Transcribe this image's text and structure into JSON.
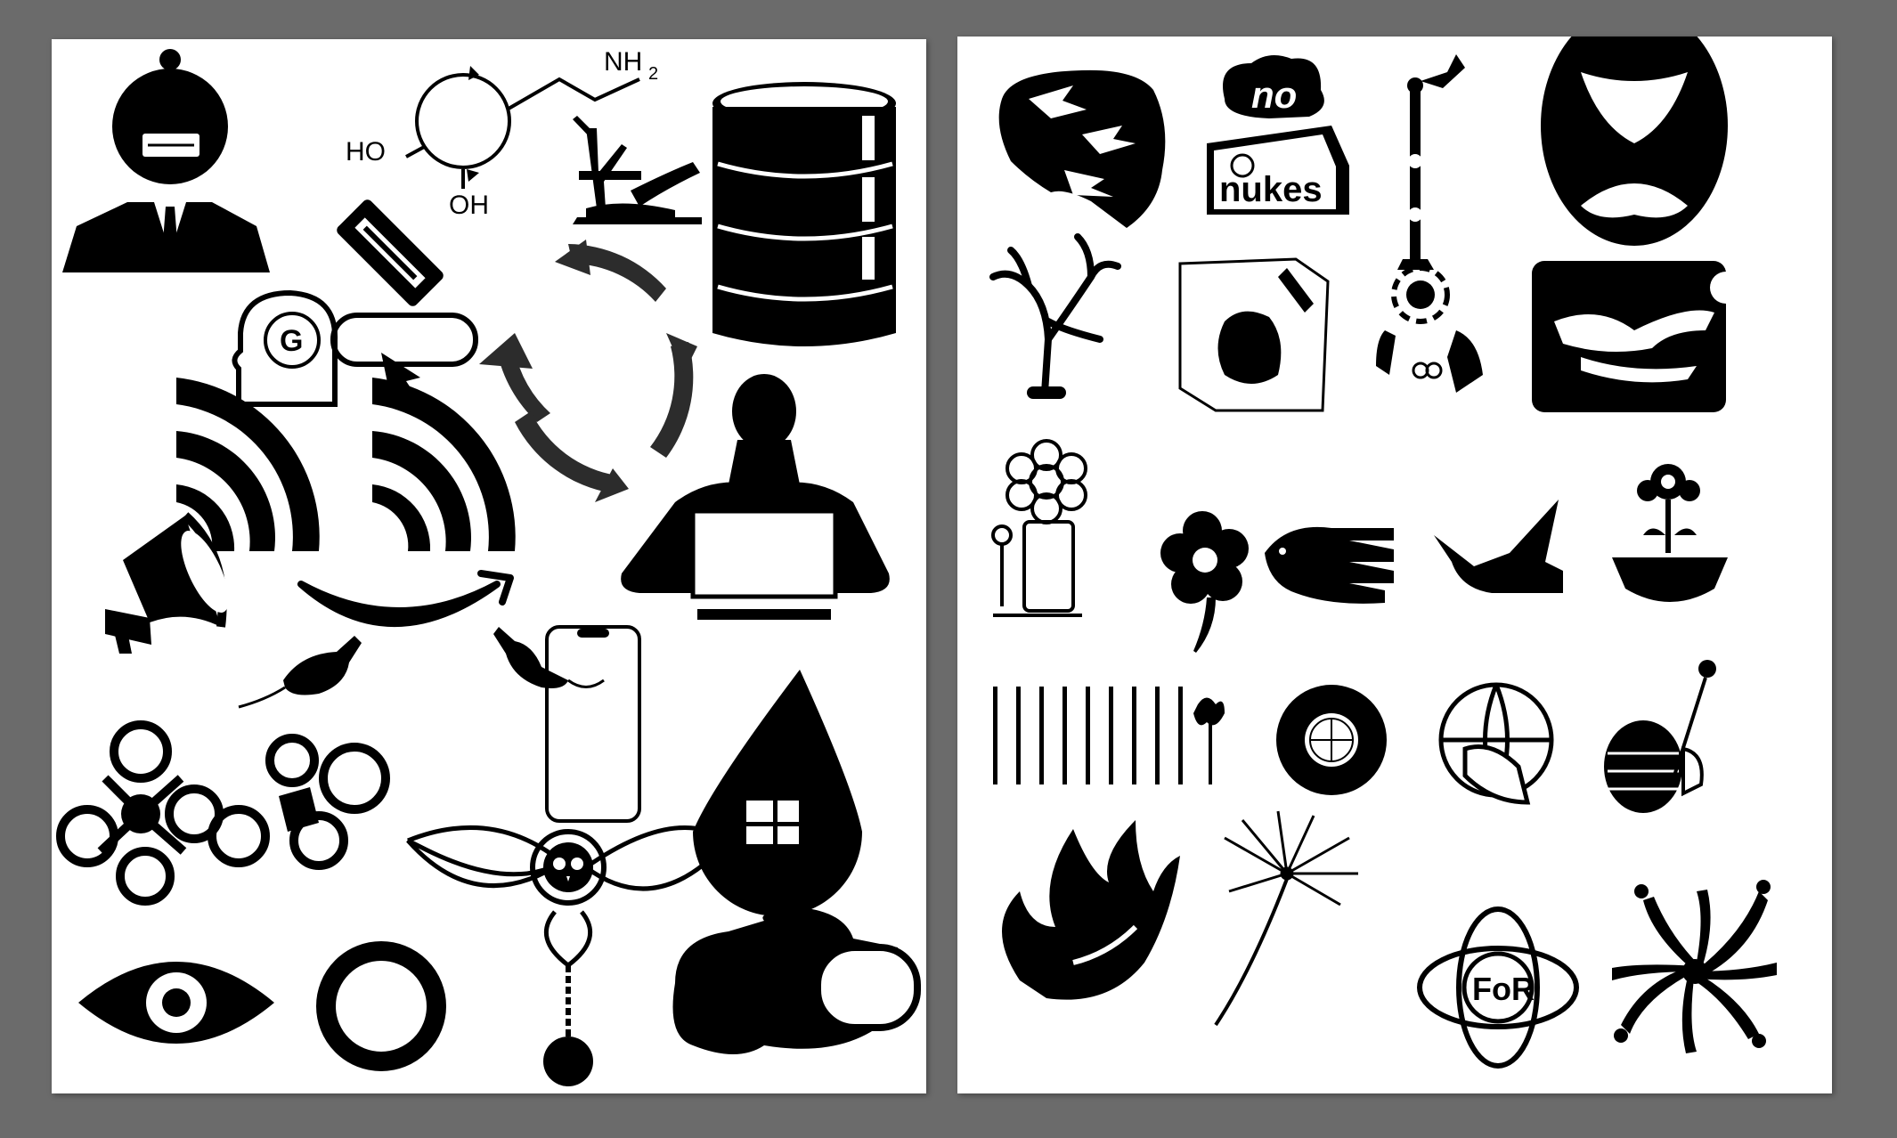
{
  "canvas": {
    "background": "#6b6b6b",
    "artboard": "#ffffff",
    "ink": "#000000",
    "accent": "#2c2c2c"
  },
  "artboards": [
    {
      "name": "left-artboard",
      "icons": [
        "razor-head-person-icon",
        "dopamine-molecule-icon",
        "dead-tree-pollution-icon",
        "oil-barrel-icon",
        "razor-blade-icon",
        "google-head-toggle-icon",
        "recycle-arrows-icon",
        "signal-waves-icon",
        "megaphone-icon",
        "laptop-person-icon",
        "amazon-smile-icon",
        "mice-icon",
        "smartphone-icon",
        "drone-icon",
        "water-drop-house-icon",
        "owl-pendant-icon",
        "eye-icon",
        "ring-icon",
        "toggle-cloud-icon"
      ]
    },
    {
      "name": "right-artboard",
      "icons": [
        "birds-map-icon",
        "no-nukes-icon",
        "human-chain-icon",
        "adinkra-symbol-icon",
        "bare-tree-icon",
        "broken-missile-icon",
        "sun-chains-icon",
        "dove-stamp-icon",
        "flower-figure-icon",
        "flower-icon",
        "dove-hands-icon",
        "dove-icon",
        "potted-flower-icon",
        "rifles-row-icon",
        "globe-flower-icon",
        "globe-dove-icon",
        "grenade-flower-icon",
        "flame-dove-icon",
        "dandelion-icon",
        "for-emblem-icon",
        "spiral-figures-icon"
      ]
    }
  ],
  "labels": {
    "nh2": "NH",
    "nh2_sub": "2",
    "ho": "HO",
    "oh": "OH",
    "google_g": "G",
    "no": "no",
    "nukes": "nukes",
    "for": "FoR"
  }
}
